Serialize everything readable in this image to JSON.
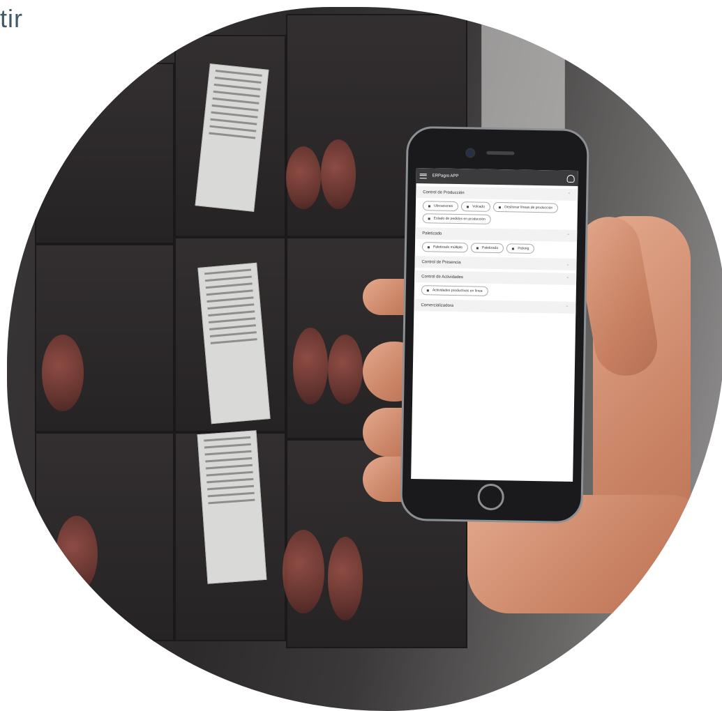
{
  "corner_text": "tir",
  "app": {
    "title": "ERPagro APP",
    "sections": [
      {
        "title": "Control de Producción",
        "expanded": true,
        "buttons": [
          "Ubicaciones",
          "Volcado",
          "Gestionar líneas de producción",
          "Estado de pedidos en producción"
        ]
      },
      {
        "title": "Paletizado",
        "expanded": true,
        "buttons": [
          "Paletizado múltiple",
          "Paletizado",
          "Picking"
        ]
      },
      {
        "title": "Control de Presencia",
        "expanded": false,
        "buttons": []
      },
      {
        "title": "Control de Actividades",
        "expanded": true,
        "buttons": [
          "Actividades productivas en línea"
        ]
      },
      {
        "title": "Comercializadora",
        "expanded": true,
        "buttons": []
      }
    ]
  },
  "colors": {
    "appbar": "#3b3b3d",
    "corner_text": "#3f5a66"
  }
}
